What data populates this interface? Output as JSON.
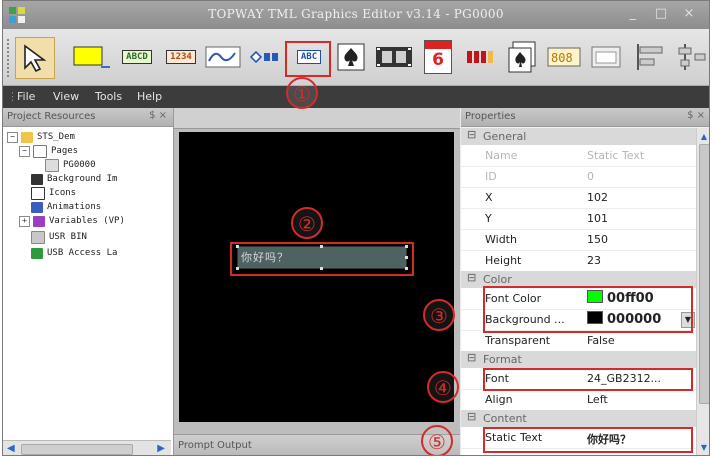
{
  "window": {
    "title": "TOPWAY TML Graphics Editor v3.14 - PG0000",
    "controls": [
      "_",
      "□",
      "×"
    ]
  },
  "toolbar": {
    "abc_label": "ABC",
    "abcd_label": "ABCD",
    "num_label": "1234",
    "cal_number": "6"
  },
  "annotations": [
    "①",
    "②",
    "③",
    "④",
    "⑤"
  ],
  "menu": [
    {
      "label": "File"
    },
    {
      "label": "View"
    },
    {
      "label": "Tools"
    },
    {
      "label": "Help"
    }
  ],
  "project_panel": {
    "title": "Project Resources",
    "controls": "$ ×",
    "items": [
      {
        "label": "STS_Dem"
      },
      {
        "label": "Pages"
      },
      {
        "label": "PG0000"
      },
      {
        "label": "Background Im"
      },
      {
        "label": "Icons"
      },
      {
        "label": "Animations"
      },
      {
        "label": "Variables (VP)"
      },
      {
        "label": "USR BIN"
      },
      {
        "label": "USB Access La"
      }
    ]
  },
  "canvas": {
    "static_text": "你好吗？"
  },
  "prompt_panel": {
    "title": "Prompt Output"
  },
  "properties": {
    "title": "Properties",
    "controls": "$ ×",
    "groups": {
      "general": "General",
      "color": "Color",
      "format": "Format",
      "content": "Content"
    },
    "rows": {
      "name": {
        "key": "Name",
        "value": "Static Text"
      },
      "id": {
        "key": "ID",
        "value": "0"
      },
      "x": {
        "key": "X",
        "value": "102"
      },
      "y": {
        "key": "Y",
        "value": "101"
      },
      "width": {
        "key": "Width",
        "value": "150"
      },
      "height": {
        "key": "Height",
        "value": "23"
      },
      "font_color": {
        "key": "Font Color",
        "value": "00ff00"
      },
      "background": {
        "key": "Background ...",
        "value": "000000"
      },
      "transparent": {
        "key": "Transparent",
        "value": "False"
      },
      "font": {
        "key": "Font",
        "value": "24_GB2312..."
      },
      "align": {
        "key": "Align",
        "value": "Left"
      },
      "static_text": {
        "key": "Static Text",
        "value": "你好吗？"
      }
    },
    "colors": {
      "font_color": "#00ff00",
      "background": "#000000"
    }
  }
}
